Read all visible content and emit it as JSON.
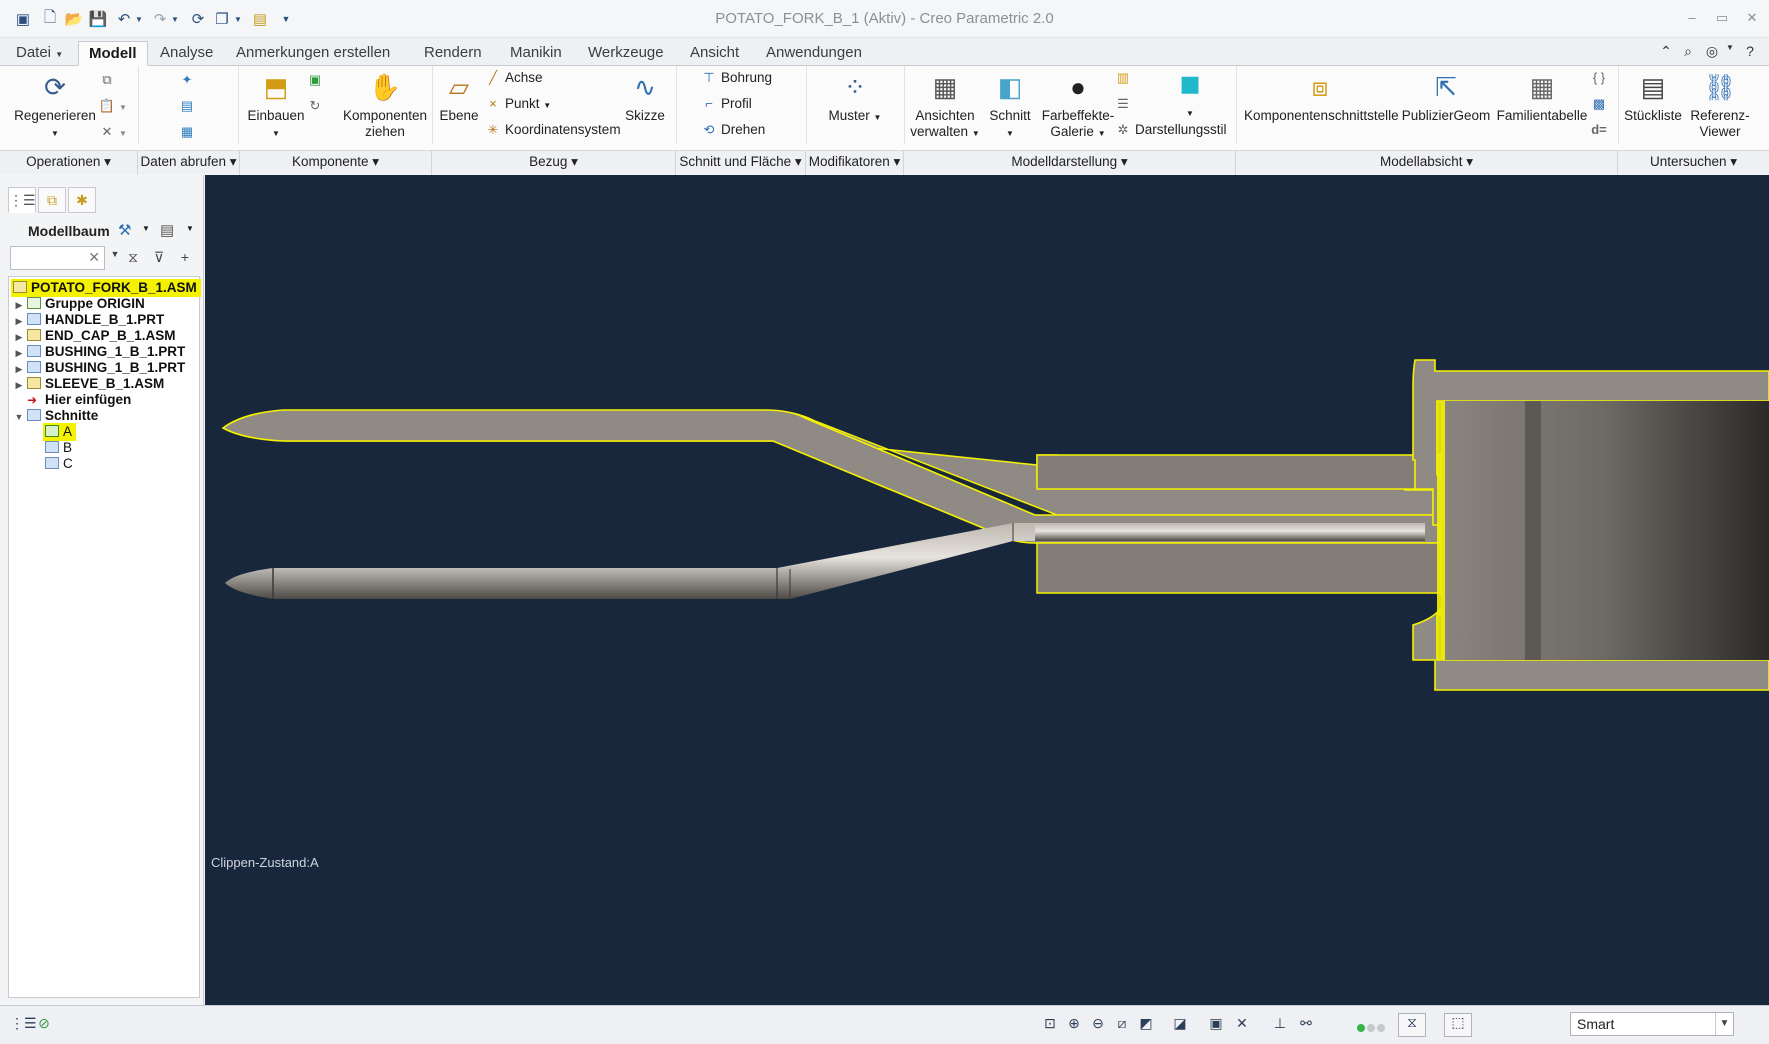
{
  "window": {
    "title": "POTATO_FORK_B_1 (Aktiv) - Creo Parametric 2.0"
  },
  "menu_tabs": [
    {
      "label": "Datei"
    },
    {
      "label": "Modell"
    },
    {
      "label": "Analyse"
    },
    {
      "label": "Anmerkungen erstellen"
    },
    {
      "label": "Rendern"
    },
    {
      "label": "Manikin"
    },
    {
      "label": "Werkzeuge"
    },
    {
      "label": "Ansicht"
    },
    {
      "label": "Anwendungen"
    }
  ],
  "ribbon": {
    "regenerieren": "Regenerieren",
    "einbauen": "Einbauen",
    "komponenten_ziehen_1": "Komponenten",
    "komponenten_ziehen_2": "ziehen",
    "ebene": "Ebene",
    "achse": "Achse",
    "punkt": "Punkt",
    "koordinatensystem": "Koordinatensystem",
    "skizze": "Skizze",
    "bohrung": "Bohrung",
    "profil": "Profil",
    "drehen": "Drehen",
    "muster": "Muster",
    "ansichten_1": "Ansichten",
    "ansichten_2": "verwalten",
    "schnitt": "Schnitt",
    "farbeffekte_1": "Farbeffekte-",
    "farbeffekte_2": "Galerie",
    "darstellungsstil": "Darstellungsstil",
    "komponentenschnittstelle": "Komponentenschnittstelle",
    "publiziergeom": "PublizierGeom",
    "familientabelle": "Familientabelle",
    "stueckliste": "Stückliste",
    "referenz_1": "Referenz-",
    "referenz_2": "Viewer"
  },
  "ribbon_groups": [
    {
      "label": "Operationen"
    },
    {
      "label": "Daten abrufen"
    },
    {
      "label": "Komponente"
    },
    {
      "label": "Bezug"
    },
    {
      "label": "Schnitt und Fläche"
    },
    {
      "label": "Modifikatoren"
    },
    {
      "label": "Modelldarstellung"
    },
    {
      "label": "Modellabsicht"
    },
    {
      "label": "Untersuchen"
    }
  ],
  "model_tree": {
    "title": "Modellbaum",
    "nodes": [
      {
        "label": "POTATO_FORK_B_1.ASM"
      },
      {
        "label": "Gruppe ORIGIN"
      },
      {
        "label": "HANDLE_B_1.PRT"
      },
      {
        "label": "END_CAP_B_1.ASM"
      },
      {
        "label": "BUSHING_1_B_1.PRT"
      },
      {
        "label": "BUSHING_1_B_1.PRT"
      },
      {
        "label": "SLEEVE_B_1.ASM"
      },
      {
        "label": "Hier einfügen"
      },
      {
        "label": "Schnitte"
      },
      {
        "label": "A"
      },
      {
        "label": "B"
      },
      {
        "label": "C"
      }
    ]
  },
  "viewport": {
    "clip_state": "Clippen-Zustand:A",
    "background": "#19273c",
    "highlight_color": "#f5f200"
  },
  "statusbar": {
    "filter": "Smart"
  },
  "icons": [
    "new-icon",
    "open-icon",
    "save-icon",
    "undo-icon",
    "redo-icon",
    "regenerate-icon",
    "search-icon",
    "help-icon",
    "filter-icon",
    "binoculars-icon"
  ]
}
